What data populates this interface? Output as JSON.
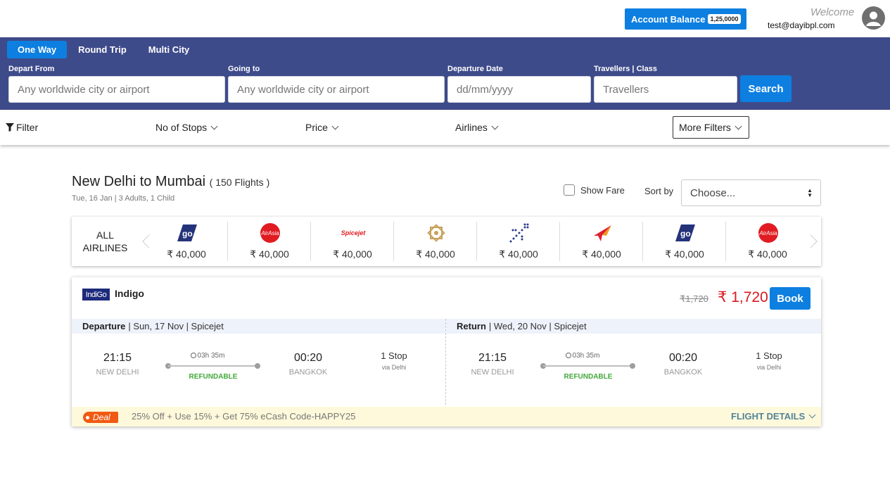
{
  "header": {
    "account_balance_label": "Account Balance",
    "account_balance_value": "1,25,0000",
    "welcome": "Welcome",
    "email": "test@dayibpl.com"
  },
  "search": {
    "trip_tabs": [
      {
        "label": "One Way",
        "active": true
      },
      {
        "label": "Round Trip",
        "active": false
      },
      {
        "label": "Multi City",
        "active": false
      }
    ],
    "depart_label": "Depart From",
    "depart_placeholder": "Any worldwide city or airport",
    "going_label": "Going to",
    "going_placeholder": "Any worldwide city or airport",
    "date_label": "Departure Date",
    "date_placeholder": "dd/mm/yyyy",
    "travellers_label": "Travellers | Class",
    "travellers_placeholder": "Travellers",
    "search_button": "Search"
  },
  "filters": {
    "filter_label": "Filter",
    "stops_label": "No of Stops",
    "price_label": "Price",
    "airlines_label": "Airlines",
    "more_filters_label": "More Filters"
  },
  "results": {
    "route_title": "New Delhi to Mumbai",
    "flight_count": "( 150 Flights )",
    "subtitle": "Tue, 16 Jan | 3 Adults, 1 Child",
    "show_fare_label": "Show Fare",
    "sort_by_label": "Sort by",
    "sort_selected": "Choose..."
  },
  "airline_strip": {
    "all_airlines_line1": "ALL",
    "all_airlines_line2": "AIRLINES",
    "airlines": [
      {
        "icon": "goair-logo",
        "price": "₹ 40,000"
      },
      {
        "icon": "airasia-logo",
        "price": "₹ 40,000"
      },
      {
        "icon": "spicejet-logo",
        "logo_text": "Spicejet",
        "price": "₹ 40,000"
      },
      {
        "icon": "vistara-logo",
        "price": "₹ 40,000"
      },
      {
        "icon": "indigo-logo",
        "price": "₹ 40,000"
      },
      {
        "icon": "airindia-logo",
        "price": "₹ 40,000"
      },
      {
        "icon": "goair-logo",
        "price": "₹ 40,000"
      },
      {
        "icon": "airasia-logo",
        "price": "₹ 40,000"
      }
    ]
  },
  "flight": {
    "logo_text": "IndiGo",
    "airline": "Indigo",
    "old_price": "₹1,720",
    "price": "₹ 1,720",
    "book_label": "Book",
    "departure": {
      "label": "Departure",
      "info": "| Sun, 17 Nov | Spicejet",
      "dep_time": "21:15",
      "dep_city": "NEW DELHI",
      "duration": "03h 35m",
      "refundable": "REFUNDABLE",
      "arr_time": "00:20",
      "arr_city": "BANGKOK",
      "stops": "1 Stop",
      "via": "via Delhi"
    },
    "return": {
      "label": "Return",
      "info": "| Wed, 20 Nov | Spicejet",
      "dep_time": "21:15",
      "dep_city": "NEW DELHI",
      "duration": "03h 35m",
      "refundable": "REFUNDABLE",
      "arr_time": "00:20",
      "arr_city": "BANGKOK",
      "stops": "1 Stop",
      "via": "via Delhi"
    },
    "deal_tag": "Deal",
    "deal_text": "25% Off + Use 15% + Get 75% eCash Code-HAPPY25",
    "details_link": "FLIGHT DETAILS"
  },
  "colors": {
    "primary": "#0d7fe0",
    "band": "#3e4b8a",
    "price_red": "#d8191f",
    "refundable_green": "#43a83b",
    "deal_orange": "#f15a12"
  }
}
